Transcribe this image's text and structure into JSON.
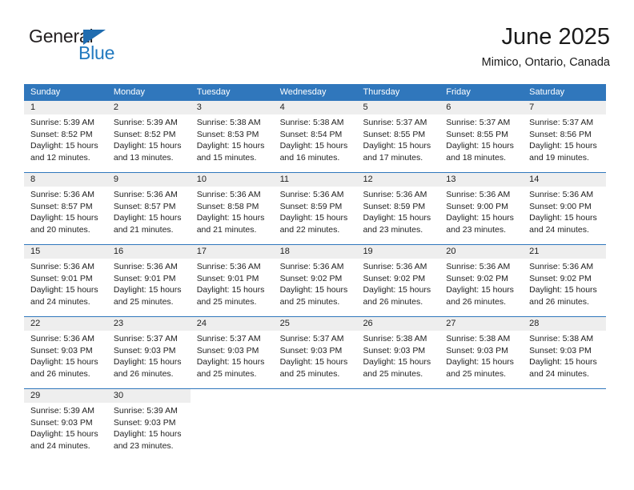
{
  "logo": {
    "word_top": "General",
    "word_bottom": "Blue",
    "triangle_icon": "triangle-icon",
    "color_text": "#231f20",
    "color_blue": "#2179bf"
  },
  "header": {
    "title": "June 2025",
    "subtitle": "Mimico, Ontario, Canada"
  },
  "theme": {
    "header_blue": "#3077bc",
    "day_band_gray": "#eeeeee",
    "text": "#222222"
  },
  "calendar": {
    "weekdays": [
      "Sunday",
      "Monday",
      "Tuesday",
      "Wednesday",
      "Thursday",
      "Friday",
      "Saturday"
    ],
    "weeks": [
      [
        {
          "day": "1",
          "sunrise": "Sunrise: 5:39 AM",
          "sunset": "Sunset: 8:52 PM",
          "daylight_l1": "Daylight: 15 hours",
          "daylight_l2": "and 12 minutes."
        },
        {
          "day": "2",
          "sunrise": "Sunrise: 5:39 AM",
          "sunset": "Sunset: 8:52 PM",
          "daylight_l1": "Daylight: 15 hours",
          "daylight_l2": "and 13 minutes."
        },
        {
          "day": "3",
          "sunrise": "Sunrise: 5:38 AM",
          "sunset": "Sunset: 8:53 PM",
          "daylight_l1": "Daylight: 15 hours",
          "daylight_l2": "and 15 minutes."
        },
        {
          "day": "4",
          "sunrise": "Sunrise: 5:38 AM",
          "sunset": "Sunset: 8:54 PM",
          "daylight_l1": "Daylight: 15 hours",
          "daylight_l2": "and 16 minutes."
        },
        {
          "day": "5",
          "sunrise": "Sunrise: 5:37 AM",
          "sunset": "Sunset: 8:55 PM",
          "daylight_l1": "Daylight: 15 hours",
          "daylight_l2": "and 17 minutes."
        },
        {
          "day": "6",
          "sunrise": "Sunrise: 5:37 AM",
          "sunset": "Sunset: 8:55 PM",
          "daylight_l1": "Daylight: 15 hours",
          "daylight_l2": "and 18 minutes."
        },
        {
          "day": "7",
          "sunrise": "Sunrise: 5:37 AM",
          "sunset": "Sunset: 8:56 PM",
          "daylight_l1": "Daylight: 15 hours",
          "daylight_l2": "and 19 minutes."
        }
      ],
      [
        {
          "day": "8",
          "sunrise": "Sunrise: 5:36 AM",
          "sunset": "Sunset: 8:57 PM",
          "daylight_l1": "Daylight: 15 hours",
          "daylight_l2": "and 20 minutes."
        },
        {
          "day": "9",
          "sunrise": "Sunrise: 5:36 AM",
          "sunset": "Sunset: 8:57 PM",
          "daylight_l1": "Daylight: 15 hours",
          "daylight_l2": "and 21 minutes."
        },
        {
          "day": "10",
          "sunrise": "Sunrise: 5:36 AM",
          "sunset": "Sunset: 8:58 PM",
          "daylight_l1": "Daylight: 15 hours",
          "daylight_l2": "and 21 minutes."
        },
        {
          "day": "11",
          "sunrise": "Sunrise: 5:36 AM",
          "sunset": "Sunset: 8:59 PM",
          "daylight_l1": "Daylight: 15 hours",
          "daylight_l2": "and 22 minutes."
        },
        {
          "day": "12",
          "sunrise": "Sunrise: 5:36 AM",
          "sunset": "Sunset: 8:59 PM",
          "daylight_l1": "Daylight: 15 hours",
          "daylight_l2": "and 23 minutes."
        },
        {
          "day": "13",
          "sunrise": "Sunrise: 5:36 AM",
          "sunset": "Sunset: 9:00 PM",
          "daylight_l1": "Daylight: 15 hours",
          "daylight_l2": "and 23 minutes."
        },
        {
          "day": "14",
          "sunrise": "Sunrise: 5:36 AM",
          "sunset": "Sunset: 9:00 PM",
          "daylight_l1": "Daylight: 15 hours",
          "daylight_l2": "and 24 minutes."
        }
      ],
      [
        {
          "day": "15",
          "sunrise": "Sunrise: 5:36 AM",
          "sunset": "Sunset: 9:01 PM",
          "daylight_l1": "Daylight: 15 hours",
          "daylight_l2": "and 24 minutes."
        },
        {
          "day": "16",
          "sunrise": "Sunrise: 5:36 AM",
          "sunset": "Sunset: 9:01 PM",
          "daylight_l1": "Daylight: 15 hours",
          "daylight_l2": "and 25 minutes."
        },
        {
          "day": "17",
          "sunrise": "Sunrise: 5:36 AM",
          "sunset": "Sunset: 9:01 PM",
          "daylight_l1": "Daylight: 15 hours",
          "daylight_l2": "and 25 minutes."
        },
        {
          "day": "18",
          "sunrise": "Sunrise: 5:36 AM",
          "sunset": "Sunset: 9:02 PM",
          "daylight_l1": "Daylight: 15 hours",
          "daylight_l2": "and 25 minutes."
        },
        {
          "day": "19",
          "sunrise": "Sunrise: 5:36 AM",
          "sunset": "Sunset: 9:02 PM",
          "daylight_l1": "Daylight: 15 hours",
          "daylight_l2": "and 26 minutes."
        },
        {
          "day": "20",
          "sunrise": "Sunrise: 5:36 AM",
          "sunset": "Sunset: 9:02 PM",
          "daylight_l1": "Daylight: 15 hours",
          "daylight_l2": "and 26 minutes."
        },
        {
          "day": "21",
          "sunrise": "Sunrise: 5:36 AM",
          "sunset": "Sunset: 9:02 PM",
          "daylight_l1": "Daylight: 15 hours",
          "daylight_l2": "and 26 minutes."
        }
      ],
      [
        {
          "day": "22",
          "sunrise": "Sunrise: 5:36 AM",
          "sunset": "Sunset: 9:03 PM",
          "daylight_l1": "Daylight: 15 hours",
          "daylight_l2": "and 26 minutes."
        },
        {
          "day": "23",
          "sunrise": "Sunrise: 5:37 AM",
          "sunset": "Sunset: 9:03 PM",
          "daylight_l1": "Daylight: 15 hours",
          "daylight_l2": "and 26 minutes."
        },
        {
          "day": "24",
          "sunrise": "Sunrise: 5:37 AM",
          "sunset": "Sunset: 9:03 PM",
          "daylight_l1": "Daylight: 15 hours",
          "daylight_l2": "and 25 minutes."
        },
        {
          "day": "25",
          "sunrise": "Sunrise: 5:37 AM",
          "sunset": "Sunset: 9:03 PM",
          "daylight_l1": "Daylight: 15 hours",
          "daylight_l2": "and 25 minutes."
        },
        {
          "day": "26",
          "sunrise": "Sunrise: 5:38 AM",
          "sunset": "Sunset: 9:03 PM",
          "daylight_l1": "Daylight: 15 hours",
          "daylight_l2": "and 25 minutes."
        },
        {
          "day": "27",
          "sunrise": "Sunrise: 5:38 AM",
          "sunset": "Sunset: 9:03 PM",
          "daylight_l1": "Daylight: 15 hours",
          "daylight_l2": "and 25 minutes."
        },
        {
          "day": "28",
          "sunrise": "Sunrise: 5:38 AM",
          "sunset": "Sunset: 9:03 PM",
          "daylight_l1": "Daylight: 15 hours",
          "daylight_l2": "and 24 minutes."
        }
      ],
      [
        {
          "day": "29",
          "sunrise": "Sunrise: 5:39 AM",
          "sunset": "Sunset: 9:03 PM",
          "daylight_l1": "Daylight: 15 hours",
          "daylight_l2": "and 24 minutes."
        },
        {
          "day": "30",
          "sunrise": "Sunrise: 5:39 AM",
          "sunset": "Sunset: 9:03 PM",
          "daylight_l1": "Daylight: 15 hours",
          "daylight_l2": "and 23 minutes."
        },
        {
          "day": "",
          "sunrise": "",
          "sunset": "",
          "daylight_l1": "",
          "daylight_l2": ""
        },
        {
          "day": "",
          "sunrise": "",
          "sunset": "",
          "daylight_l1": "",
          "daylight_l2": ""
        },
        {
          "day": "",
          "sunrise": "",
          "sunset": "",
          "daylight_l1": "",
          "daylight_l2": ""
        },
        {
          "day": "",
          "sunrise": "",
          "sunset": "",
          "daylight_l1": "",
          "daylight_l2": ""
        },
        {
          "day": "",
          "sunrise": "",
          "sunset": "",
          "daylight_l1": "",
          "daylight_l2": ""
        }
      ]
    ]
  }
}
